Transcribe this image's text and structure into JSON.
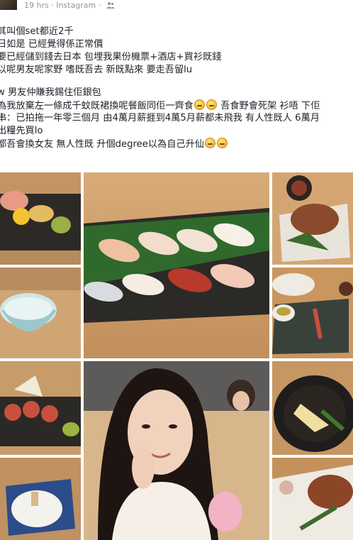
{
  "post": {
    "meta": {
      "time": "19 hrs",
      "separator": "·",
      "source": "Instagram",
      "privacy_icon": "friends-icon"
    },
    "lines": [
      "其叫個set都近2千",
      "日如是 已經覺得係正常價",
      "要已經儲到錢去日本 包埋我果份機票+酒店+買衫既錢",
      "以呢男友呢家野 嗜既吾去 新既點來 要走吾留lu",
      "w 男友仲賺我錫住佢銀包",
      "為我放棄左一條成千蚊既裙換呢餐飯同佢一齊食",
      "吾食野會死架 衫唔 下佢",
      "串：已拍拖一年零三個月 由4萬月薪捱到4萬5月薪都未飛我 有人性既人 6萬月",
      "出糧先買lo",
      "都吾會換女友 無人性既 升個degree以為自己升仙"
    ]
  },
  "colors": {
    "text": "#1d2129",
    "meta": "#90949c",
    "wood": "#c99a62"
  },
  "photos": [
    "sushi-plate-photo",
    "nigiri-platter-photo",
    "grilled-fish-photo",
    "sake-cup-photo",
    "appetizer-photo",
    "roll-photo",
    "selfie-photo",
    "soup-bowl-photo",
    "dessert-photo",
    "meat-photo"
  ]
}
